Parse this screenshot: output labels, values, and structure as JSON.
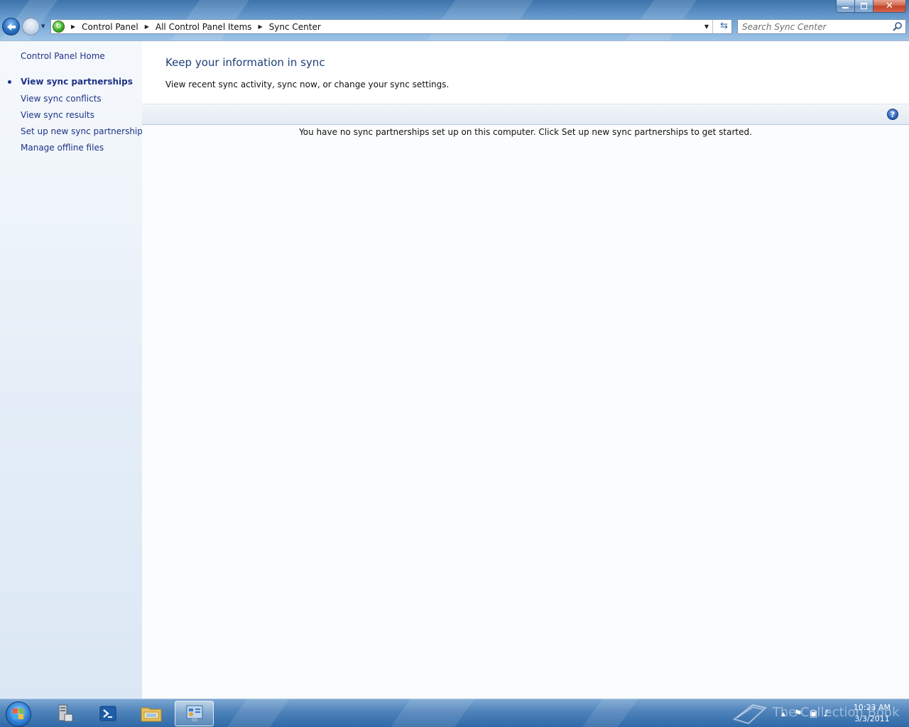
{
  "address_bar": {
    "breadcrumbs": [
      {
        "label": "Control Panel"
      },
      {
        "label": "All Control Panel Items"
      },
      {
        "label": "Sync Center"
      }
    ]
  },
  "search": {
    "placeholder": "Search Sync Center"
  },
  "sidebar": {
    "home_link": "Control Panel Home",
    "items": [
      {
        "label": "View sync partnerships",
        "selected": true
      },
      {
        "label": "View sync conflicts",
        "selected": false
      },
      {
        "label": "View sync results",
        "selected": false
      },
      {
        "label": "Set up new sync partnerships",
        "selected": false
      },
      {
        "label": "Manage offline files",
        "selected": false
      }
    ]
  },
  "main": {
    "title": "Keep your information in sync",
    "description": "View recent sync activity, sync now, or change your sync settings.",
    "empty_message": "You have no sync partnerships set up on this computer. Click Set up new sync partnerships to get started."
  },
  "help_button": {
    "label": "?"
  },
  "taskbar": {
    "items": [
      {
        "icon": "server-manager-icon",
        "active": false
      },
      {
        "icon": "powershell-icon",
        "active": false
      },
      {
        "icon": "windows-explorer-icon",
        "active": false
      },
      {
        "icon": "control-panel-icon",
        "active": true
      }
    ],
    "watermark": "The Collection Book",
    "clock": {
      "time": "10:23 AM",
      "date": "3/3/2011"
    }
  },
  "colors": {
    "link": "#1e3287",
    "title": "#1e3f77",
    "taskbar": "#3a72ad"
  }
}
